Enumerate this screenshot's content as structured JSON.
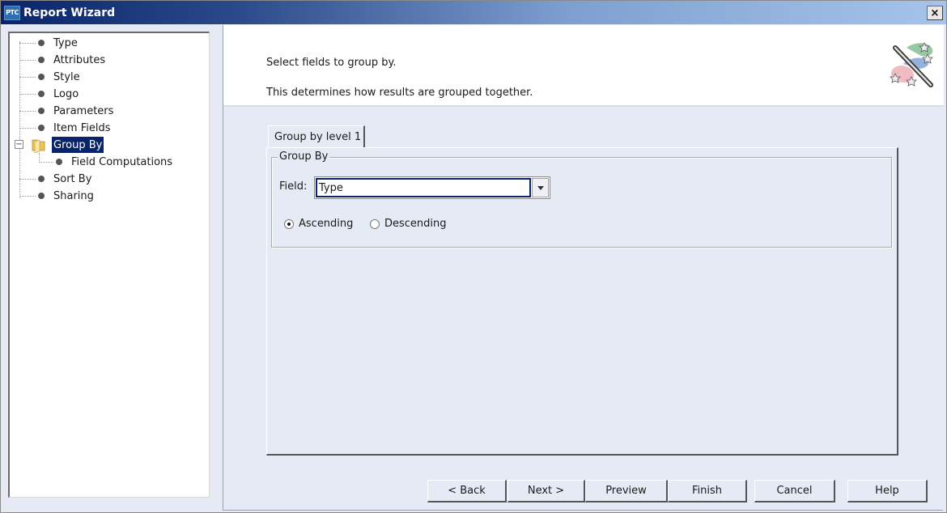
{
  "window": {
    "title": "Report Wizard",
    "logo_text": "PTC",
    "close_label": "×"
  },
  "tree": {
    "items": [
      {
        "label": "Type"
      },
      {
        "label": "Attributes"
      },
      {
        "label": "Style"
      },
      {
        "label": "Logo"
      },
      {
        "label": "Parameters"
      },
      {
        "label": "Item Fields"
      },
      {
        "label": "Group By",
        "selected": true,
        "expanded": true
      },
      {
        "label": "Field Computations",
        "child": true
      },
      {
        "label": "Sort By"
      },
      {
        "label": "Sharing"
      }
    ],
    "expander_symbol": "−"
  },
  "header": {
    "line1": "Select fields to group by.",
    "line2": "This determines how results are grouped together.",
    "icon": "magic-wand-icon"
  },
  "tabs": [
    {
      "label": "Group by level 1",
      "active": true
    }
  ],
  "group_box": {
    "legend": "Group By",
    "field_label": "Field:",
    "field_value": "Type",
    "sort_options": [
      {
        "label": "Ascending",
        "checked": true
      },
      {
        "label": "Descending",
        "checked": false
      }
    ]
  },
  "buttons": {
    "back": "< Back",
    "next": "Next >",
    "preview": "Preview",
    "finish": "Finish",
    "cancel": "Cancel",
    "help": "Help"
  },
  "colors": {
    "selection": "#0a246a",
    "panel_bg": "#e6eaf5",
    "title_gradient_start": "#0a246a",
    "title_gradient_end": "#a6c4ea"
  }
}
